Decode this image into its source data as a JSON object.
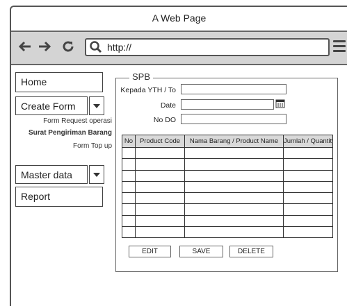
{
  "window": {
    "title": "A Web Page"
  },
  "browser": {
    "url": "http://"
  },
  "sidebar": {
    "home": "Home",
    "create_form": "Create Form",
    "sub_items": [
      "Form Request operasi",
      "Surat Pengiriman Barang",
      "Form Top up"
    ],
    "master_data": "Master data",
    "report": "Report"
  },
  "form": {
    "legend": "SPB",
    "fields": [
      {
        "label": "Kepada YTH / To",
        "value": ""
      },
      {
        "label": "Date",
        "value": ""
      },
      {
        "label": "No DO",
        "value": ""
      }
    ]
  },
  "table": {
    "headers": [
      "No",
      "Product Code",
      "Nama Barang / Product Name",
      "Jumlah / Quantity"
    ],
    "rows": [
      [
        "",
        "",
        "",
        ""
      ],
      [
        "",
        "",
        "",
        ""
      ],
      [
        "",
        "",
        "",
        ""
      ],
      [
        "",
        "",
        "",
        ""
      ],
      [
        "",
        "",
        "",
        ""
      ],
      [
        "",
        "",
        "",
        ""
      ],
      [
        "",
        "",
        "",
        ""
      ],
      [
        "",
        "",
        "",
        ""
      ]
    ]
  },
  "actions": {
    "edit": "EDIT",
    "save": "SAVE",
    "delete": "DELETE"
  },
  "icons": [
    "back-arrow-icon",
    "forward-arrow-icon",
    "reload-icon",
    "search-icon",
    "menu-icon",
    "calendar-icon",
    "chevron-down-icon"
  ]
}
